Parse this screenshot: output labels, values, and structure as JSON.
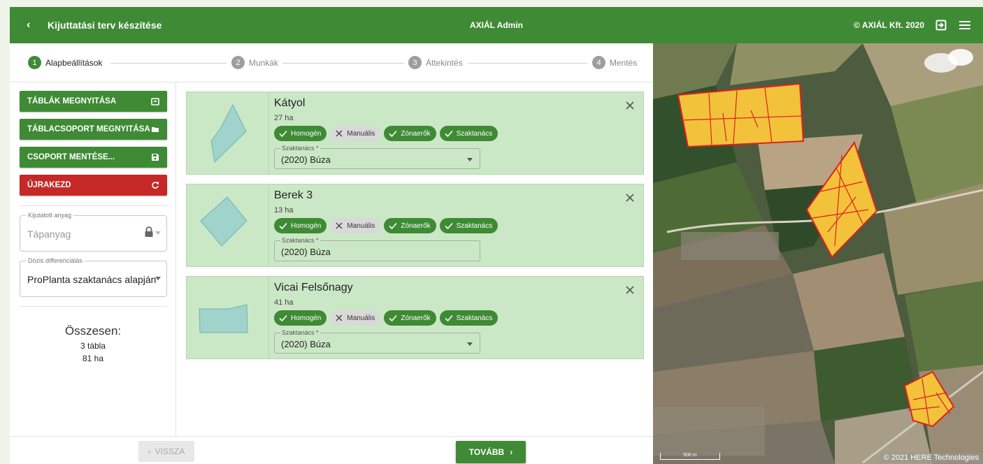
{
  "header": {
    "back_glyph": "‹",
    "title": "Kijuttatási terv készítése",
    "center": "AXIÁL Admin",
    "copyright": "© AXIÁL Kft. 2020"
  },
  "steps": [
    {
      "num": "1",
      "label": "Alapbeállítások",
      "active": true
    },
    {
      "num": "2",
      "label": "Munkák"
    },
    {
      "num": "3",
      "label": "Áttekintés"
    },
    {
      "num": "4",
      "label": "Mentés"
    }
  ],
  "sidebar": {
    "buttons": [
      {
        "label": "TÁBLÁK MEGNYITÁSA",
        "icon": "open-box-icon"
      },
      {
        "label": "TÁBLACSOPORT MEGNYITÁSA",
        "icon": "folder-open-icon"
      },
      {
        "label": "CSOPORT MENTÉSE...",
        "icon": "save-icon"
      },
      {
        "label": "ÚJRAKEZD",
        "icon": "refresh-icon"
      }
    ],
    "material": {
      "label": "Kijutatott anyag",
      "value": "Tápanyag"
    },
    "dose": {
      "label": "Dózis differenciálás",
      "value": "ProPlanta szaktanács alapján"
    },
    "total": {
      "title": "Összesen:",
      "fields": "3 tábla",
      "area": "81 ha"
    }
  },
  "chip_labels": [
    "Homogén",
    "Manuális",
    "Zónaerők",
    "Szaktanács"
  ],
  "cards": [
    {
      "name": "Kátyol",
      "area": "27 ha",
      "select_label": "Szaktanács *",
      "select_value": "(2020) Búza"
    },
    {
      "name": "Berek 3",
      "area": "13 ha",
      "select_label": "Szaktanács *",
      "select_value": "(2020) Búza"
    },
    {
      "name": "Vicai Felsőnagy",
      "area": "41 ha",
      "select_label": "Szaktanács *",
      "select_value": "(2020) Búza"
    }
  ],
  "footer": {
    "back": "VISSZA",
    "next": "TOVÁBB"
  },
  "map": {
    "copyright": "© 2021 HERE Technologies",
    "scale": "500 m"
  },
  "colors": {
    "primary": "#3f8a35",
    "danger": "#c62828",
    "card_bg": "#cbe8c6",
    "field_fill": "#f2c23a",
    "field_border": "#e02020"
  }
}
